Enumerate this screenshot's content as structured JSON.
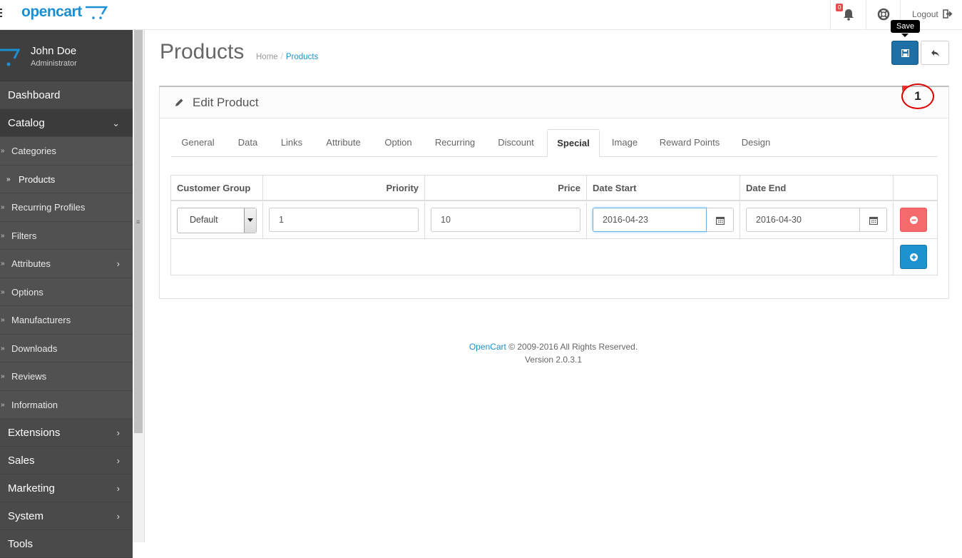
{
  "header": {
    "logo": "opencart",
    "notification_count": "0",
    "logout_label": "Logout"
  },
  "profile": {
    "name": "John Doe",
    "role": "Administrator"
  },
  "sidebar": {
    "top": [
      {
        "label": "Dashboard"
      },
      {
        "label": "Catalog"
      }
    ],
    "catalog_items": [
      {
        "label": "Categories"
      },
      {
        "label": "Products"
      },
      {
        "label": "Recurring Profiles"
      },
      {
        "label": "Filters"
      },
      {
        "label": "Attributes"
      },
      {
        "label": "Options"
      },
      {
        "label": "Manufacturers"
      },
      {
        "label": "Downloads"
      },
      {
        "label": "Reviews"
      },
      {
        "label": "Information"
      }
    ],
    "bottom": [
      {
        "label": "Extensions"
      },
      {
        "label": "Sales"
      },
      {
        "label": "Marketing"
      },
      {
        "label": "System"
      },
      {
        "label": "Tools"
      }
    ]
  },
  "page": {
    "title": "Products",
    "breadcrumb": [
      "Home",
      "Products"
    ],
    "save_tooltip": "Save",
    "annotation": "1"
  },
  "panel": {
    "title": "Edit Product",
    "tabs": [
      "General",
      "Data",
      "Links",
      "Attribute",
      "Option",
      "Recurring",
      "Discount",
      "Special",
      "Image",
      "Reward Points",
      "Design"
    ],
    "active_tab": "Special"
  },
  "special_table": {
    "headers": [
      "Customer Group",
      "Priority",
      "Price",
      "Date Start",
      "Date End"
    ],
    "row": {
      "customer_group": "Default",
      "priority": "1",
      "price": "10",
      "date_start": "2016-04-23",
      "date_end": "2016-04-30"
    }
  },
  "footer": {
    "link": "OpenCart",
    "copyright": "© 2009-2016 All Rights Reserved.",
    "version": "Version 2.0.3.1"
  },
  "colors": {
    "brand": "#1e91cf",
    "sidebar": "#515151",
    "danger": "#f56b6b",
    "save": "#1e6fa6"
  }
}
